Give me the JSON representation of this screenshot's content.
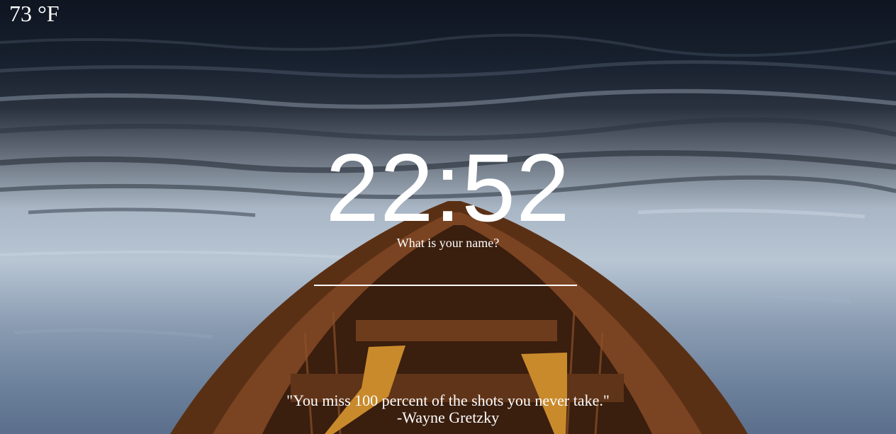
{
  "weather": {
    "temperature": "73 °F"
  },
  "clock": {
    "time": "22:52"
  },
  "greeting": {
    "prompt": "What is your name?",
    "input_value": ""
  },
  "quote": {
    "text": "\"You miss 100 percent of the shots you never take.\"",
    "author": "-Wayne Gretzky"
  },
  "background": {
    "description_colors": {
      "water_dark": "#0f1521",
      "water_light": "#b8c6d4",
      "boat_wood": "#6b3a1c",
      "oar": "#c98a2c"
    }
  }
}
